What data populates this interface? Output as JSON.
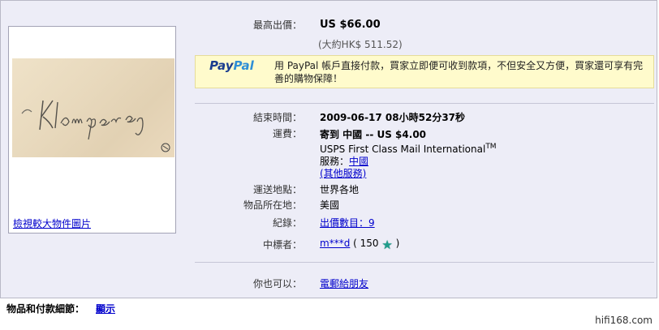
{
  "listing": {
    "highest_bid_label": "最高出價：",
    "highest_bid_value": "US $66.00",
    "approx_value": "(大約HK$ 511.52)",
    "end_time_label": "結束時間：",
    "end_time_value": "2009-06-17 08小時52分37秒",
    "shipping_label": "運費：",
    "shipping_line1": "寄到 中國 -- US $4.00",
    "shipping_service_name": "USPS First Class Mail International",
    "shipping_service_tm": "TM",
    "shipping_service_label": "服務：",
    "shipping_service_link": "中國",
    "other_services_link": "(其他服務)",
    "ships_to_label": "運送地點：",
    "ships_to_value": "世界各地",
    "location_label": "物品所在地：",
    "location_value": "美國",
    "history_label": "紀錄：",
    "history_link": "出價數目：9",
    "winner_label": "中標者：",
    "winner_link": "m***d",
    "winner_feedback": "( 150",
    "winner_close": ")",
    "also_label": "你也可以：",
    "also_link": "電郵給朋友"
  },
  "paypal": {
    "logo_part1": "Pay",
    "logo_part2": "Pal",
    "text": "用 PayPal 帳戶直接付款，買家立即便可收到款項，不但安全又方便，買家還可享有完善的購物保障！"
  },
  "image": {
    "enlarge_link": "檢視較大物件圖片",
    "signature_text": "Klemperer"
  },
  "footer": {
    "details_label": "物品和付款細節：",
    "show_link": "顯示",
    "watermark": "hifi168.com"
  },
  "colors": {
    "panel_bg": "#ededf7",
    "link": "#0000cc",
    "paypal_bg": "#fffbcc",
    "star": "#1e9c8b"
  }
}
